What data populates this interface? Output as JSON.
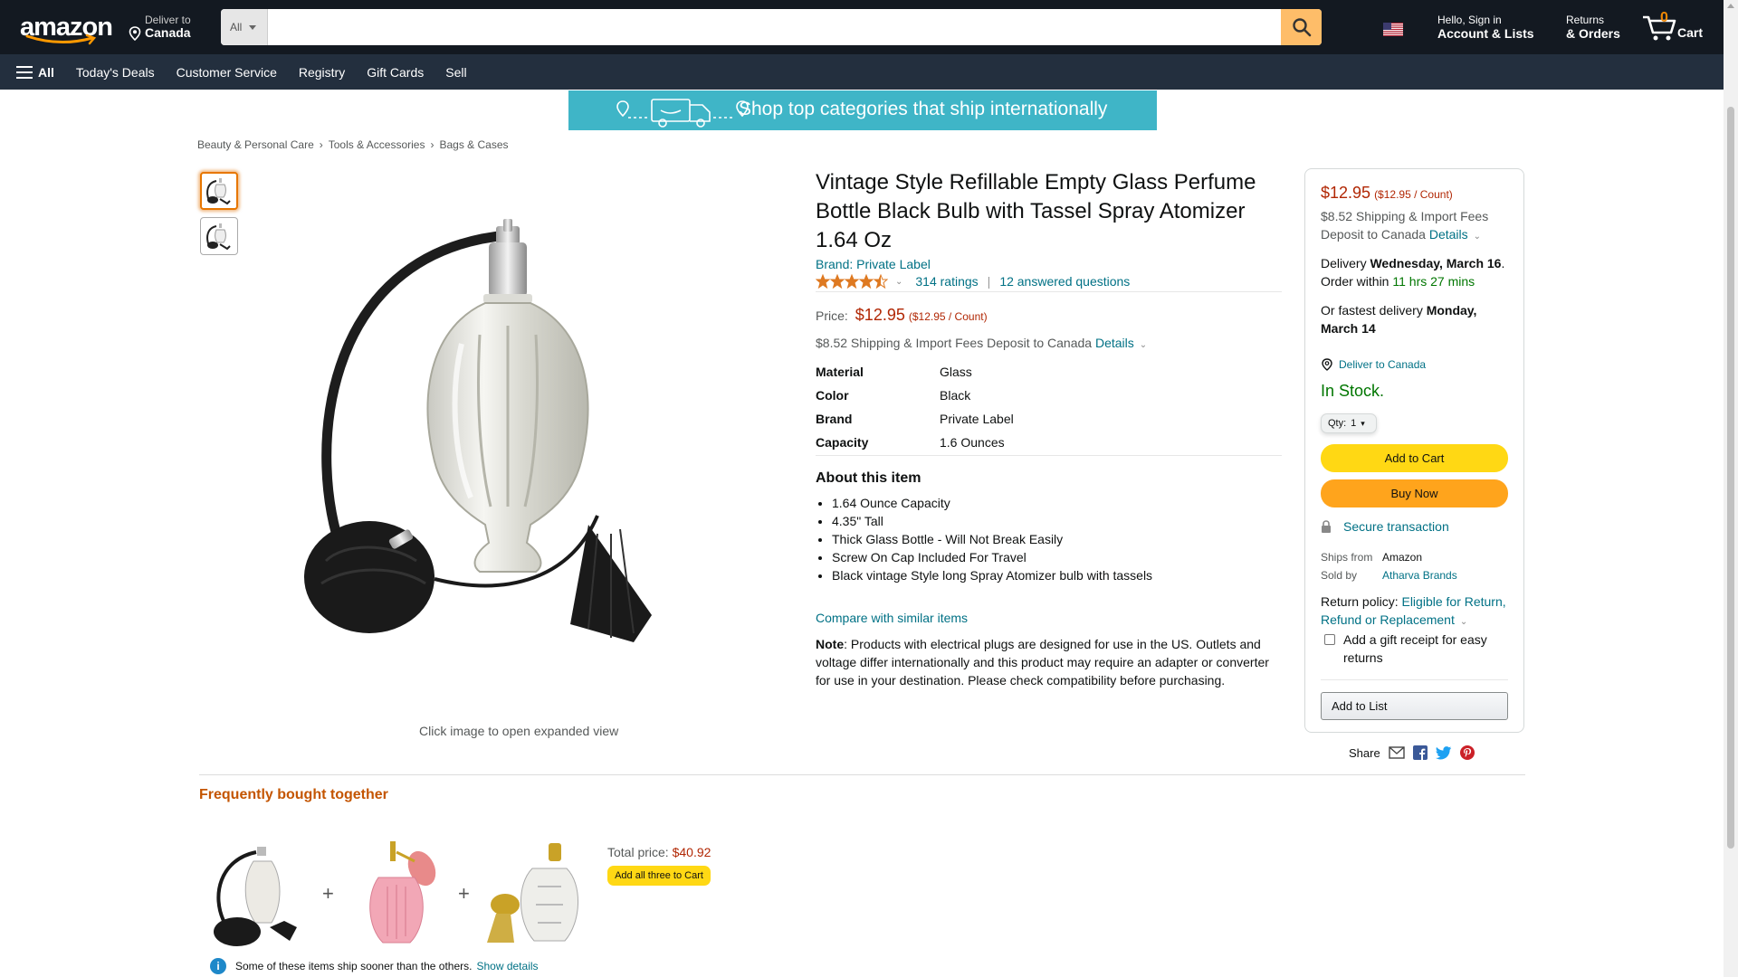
{
  "header": {
    "logo_text": "amazon",
    "deliver_small": "Deliver to",
    "deliver_big": "Canada",
    "search_category": "All",
    "search_placeholder": "",
    "account_small": "Hello, Sign in",
    "account_big": "Account & Lists",
    "returns_small": "Returns",
    "returns_big": "& Orders",
    "cart_count": "0",
    "cart_label": "Cart"
  },
  "subnav": {
    "all": "All",
    "items": [
      "Today's Deals",
      "Customer Service",
      "Registry",
      "Gift Cards",
      "Sell"
    ]
  },
  "banner": {
    "text": "Shop top categories that ship internationally"
  },
  "breadcrumb": [
    "Beauty & Personal Care",
    "Tools & Accessories",
    "Bags & Cases"
  ],
  "gallery": {
    "expand_text": "Click image to open expanded view"
  },
  "product": {
    "title": "Vintage Style Refillable Empty Glass Perfume Bottle Black Bulb with Tassel Spray Atomizer 1.64 Oz",
    "brand": "Brand: Private Label",
    "rating_value": 4.5,
    "ratings": "314 ratings",
    "pipe": "|",
    "questions": "12 answered questions",
    "price_label": "Price:",
    "price": "$12.95",
    "unit_price": "($12.95 / Count)",
    "shipping_fee": "$8.52 Shipping & Import Fees Deposit to Canada",
    "details_link": "Details",
    "specs": [
      {
        "k": "Material",
        "v": "Glass"
      },
      {
        "k": "Color",
        "v": "Black"
      },
      {
        "k": "Brand",
        "v": "Private Label"
      },
      {
        "k": "Capacity",
        "v": "1.6 Ounces"
      }
    ],
    "about_heading": "About this item",
    "about": [
      "1.64 Ounce Capacity",
      "4.35\" Tall",
      "Thick Glass Bottle - Will Not Break Easily",
      "Screw On Cap Included For Travel",
      "Black vintage Style long Spray Atomizer bulb with tassels"
    ],
    "compare": "Compare with similar items",
    "note_label": "Note",
    "note_text": ": Products with electrical plugs are designed for use in the US. Outlets and voltage differ internationally and this product may require an adapter or converter for use in your destination. Please check compatibility before purchasing."
  },
  "buybox": {
    "price": "$12.95",
    "unit_price": "($12.95 / Count)",
    "fee_line1": "$8.52 Shipping & Import Fees",
    "fee_line2": "Deposit to Canada",
    "details": "Details",
    "delivery_pre": "Delivery ",
    "delivery_date": "Wednesday, March 16",
    "delivery_dot": ".",
    "order_pre": "Order within ",
    "order_time": "11 hrs 27 mins",
    "fastest_pre": "Or fastest delivery ",
    "fastest_date": "Monday, March 14",
    "deliver_to": "Deliver to Canada",
    "in_stock": "In Stock.",
    "qty_label": "Qty:",
    "qty_value": "1",
    "add_to_cart": "Add to Cart",
    "buy_now": "Buy Now",
    "secure": "Secure transaction",
    "ships_from_label": "Ships from",
    "ships_from": "Amazon",
    "sold_by_label": "Sold by",
    "sold_by": "Atharva Brands",
    "return_label": "Return policy: ",
    "return_link": "Eligible for Return, Refund or Replacement",
    "gift": "Add a gift receipt for easy returns",
    "add_to_list": "Add to List",
    "share": "Share"
  },
  "fbt": {
    "heading": "Frequently bought together",
    "plus": "+",
    "total_label": "Total price: ",
    "total": "$40.92",
    "add_all": "Add all three to Cart",
    "info": "Some of these items ship sooner than the others.",
    "show_details": "Show details"
  },
  "colors": {
    "nav_dark": "#131921",
    "nav_sub": "#232f3e",
    "search_btn": "#febd69",
    "price": "#b12704",
    "link": "#007185",
    "in_stock": "#007600",
    "add_cart": "#ffd814",
    "buy_now": "#ffa41c"
  }
}
